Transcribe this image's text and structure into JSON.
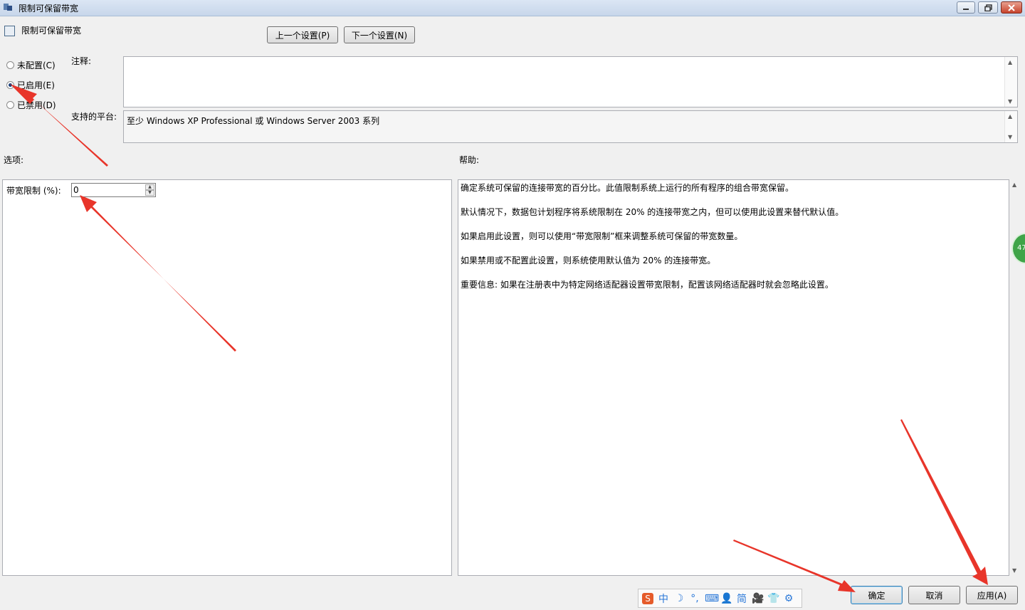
{
  "window": {
    "title": "限制可保留带宽",
    "controls": [
      "minimize",
      "restore",
      "close"
    ]
  },
  "header": {
    "policy_name": "限制可保留带宽",
    "prev_button": "上一个设置(P)",
    "next_button": "下一个设置(N)"
  },
  "state": {
    "options": [
      {
        "label": "未配置(C)",
        "selected": false
      },
      {
        "label": "已启用(E)",
        "selected": true
      },
      {
        "label": "已禁用(D)",
        "selected": false
      }
    ]
  },
  "comment": {
    "label": "注释:",
    "value": ""
  },
  "platform": {
    "label": "支持的平台:",
    "value": "至少 Windows XP Professional 或 Windows Server 2003 系列"
  },
  "options_pane": {
    "header": "选项:",
    "bandwidth_label": "带宽限制 (%):",
    "bandwidth_value": "0"
  },
  "help_pane": {
    "header": "帮助:",
    "paragraphs": [
      "确定系统可保留的连接带宽的百分比。此值限制系统上运行的所有程序的组合带宽保留。",
      "默认情况下，数据包计划程序将系统限制在 20% 的连接带宽之内，但可以使用此设置来替代默认值。",
      "如果启用此设置，则可以使用“带宽限制”框来调整系统可保留的带宽数量。",
      "如果禁用或不配置此设置，则系统使用默认值为 20% 的连接带宽。",
      "重要信息: 如果在注册表中为特定网络适配器设置带宽限制，配置该网络适配器时就会忽略此设置。"
    ]
  },
  "side_badge": "47",
  "footer": {
    "ok": "确定",
    "cancel": "取消",
    "apply": "应用(A)"
  },
  "ime_toolbar": {
    "items": [
      "中",
      "☽",
      "°,",
      "⌨",
      "👤",
      "简",
      "🎥",
      "👕",
      "⚙"
    ],
    "logo": "S"
  },
  "colors": {
    "annotation_arrow": "#e8352a",
    "title_bar": "#c7d6ea",
    "close_button": "#c7432c"
  }
}
